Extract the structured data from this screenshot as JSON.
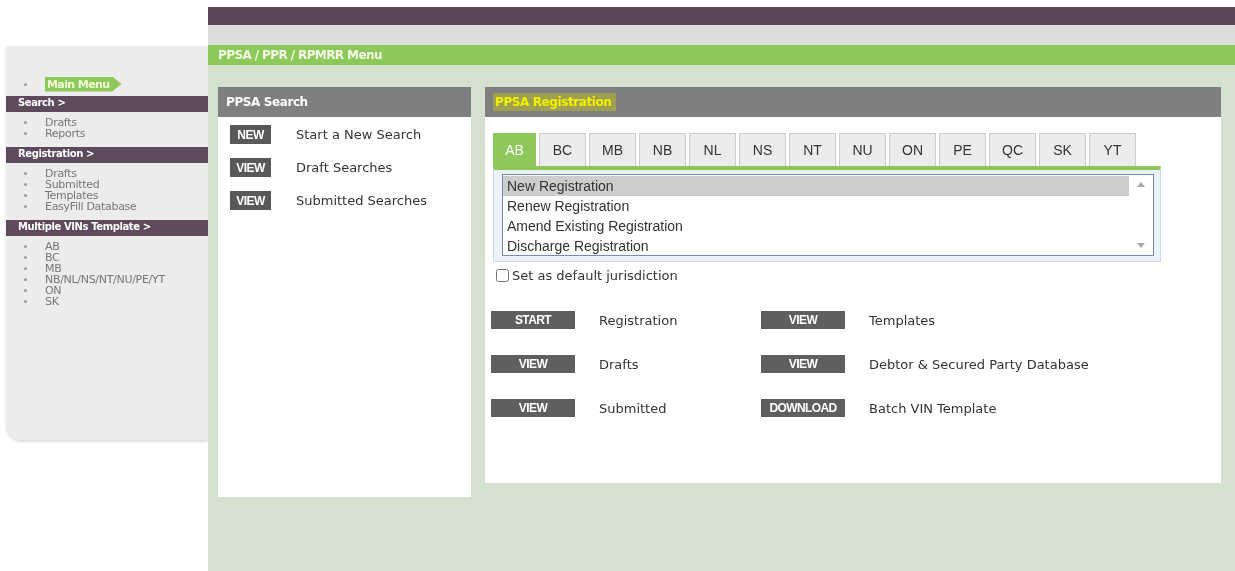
{
  "sidebar": {
    "main_menu": {
      "label": "Main Menu",
      "selected": true
    },
    "sections": [
      {
        "title": "Search >",
        "items": [
          "Drafts",
          "Reports"
        ]
      },
      {
        "title": "Registration >",
        "items": [
          "Drafts",
          "Submitted",
          "Templates",
          "EasyFill Database"
        ]
      },
      {
        "title": "Multiple VINs Template >",
        "items": [
          "AB",
          "BC",
          "MB",
          "NB/NL/NS/NT/NU/PE/YT",
          "ON",
          "SK"
        ]
      }
    ]
  },
  "menu_title": "PPSA / PPR / RPMRR Menu",
  "search_panel": {
    "title": "PPSA Search",
    "actions": [
      {
        "button": "NEW",
        "label": "Start a New Search"
      },
      {
        "button": "VIEW",
        "label": "Draft Searches"
      },
      {
        "button": "VIEW",
        "label": "Submitted Searches"
      }
    ]
  },
  "registration_panel": {
    "title": "PPSA Registration",
    "title_highlighted": true,
    "tabs": [
      {
        "label": "AB",
        "selected": true
      },
      {
        "label": "BC",
        "selected": false
      },
      {
        "label": "MB",
        "selected": false
      },
      {
        "label": "NB",
        "selected": false
      },
      {
        "label": "NL",
        "selected": false
      },
      {
        "label": "NS",
        "selected": false
      },
      {
        "label": "NT",
        "selected": false
      },
      {
        "label": "NU",
        "selected": false
      },
      {
        "label": "ON",
        "selected": false
      },
      {
        "label": "PE",
        "selected": false
      },
      {
        "label": "QC",
        "selected": false
      },
      {
        "label": "SK",
        "selected": false
      },
      {
        "label": "YT",
        "selected": false
      }
    ],
    "options": [
      {
        "label": "New Registration",
        "selected": true
      },
      {
        "label": "Renew Registration",
        "selected": false
      },
      {
        "label": "Amend Existing Registration",
        "selected": false
      },
      {
        "label": "Discharge Registration",
        "selected": false
      }
    ],
    "default_checkbox": {
      "label": "Set as default jurisdiction",
      "checked": false
    },
    "actions": [
      {
        "button": "START",
        "label": "Registration"
      },
      {
        "button": "VIEW",
        "label": "Templates"
      },
      {
        "button": "VIEW",
        "label": "Drafts"
      },
      {
        "button": "VIEW",
        "label": "Debtor & Secured Party Database"
      },
      {
        "button": "VIEW",
        "label": "Submitted"
      },
      {
        "button": "DOWNLOAD",
        "label": "Batch VIN Template"
      }
    ]
  }
}
